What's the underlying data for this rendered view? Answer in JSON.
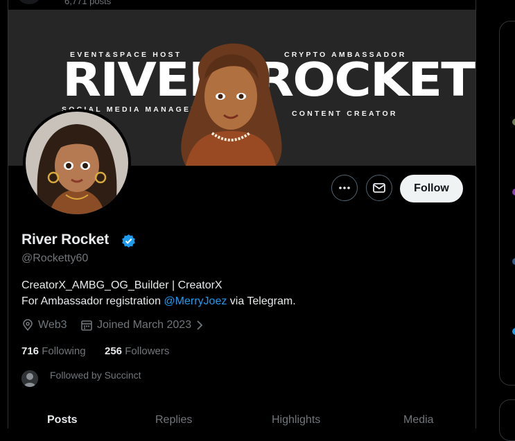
{
  "top": {
    "post_count": "6,771 posts"
  },
  "banner": {
    "tag_event": "EVENT&SPACE HOST",
    "tag_crypto": "CRYPTO AMBASSADOR",
    "tag_social": "SOCIAL MEDIA MANAGER",
    "tag_content": "CONTENT CREATOR",
    "word_left": "RIVER",
    "word_right": "ROCKET"
  },
  "actions": {
    "follow_label": "Follow"
  },
  "profile": {
    "name": "River Rocket",
    "handle": "@Rocketty60",
    "bio_line1": "CreatorX_AMBG_OG_Builder | CreatorX",
    "bio_line2_prefix": "For Ambassador registration ",
    "bio_mention": "@MerryJoez",
    "bio_line2_suffix": " via Telegram.",
    "location": "Web3",
    "joined": "Joined March 2023",
    "following_count": "716",
    "following_label": "Following",
    "followers_count": "256",
    "followers_label": "Followers",
    "followed_by": "Followed by Succinct"
  },
  "tabs": [
    "Posts",
    "Replies",
    "Highlights",
    "Media"
  ],
  "colors": {
    "accent": "#1d9bf0",
    "background": "#000000",
    "muted": "#71767b",
    "banner": "#262626"
  },
  "icons": [
    "more-icon",
    "message-icon",
    "verified-icon",
    "location-icon",
    "calendar-icon",
    "chevron-right-icon"
  ]
}
